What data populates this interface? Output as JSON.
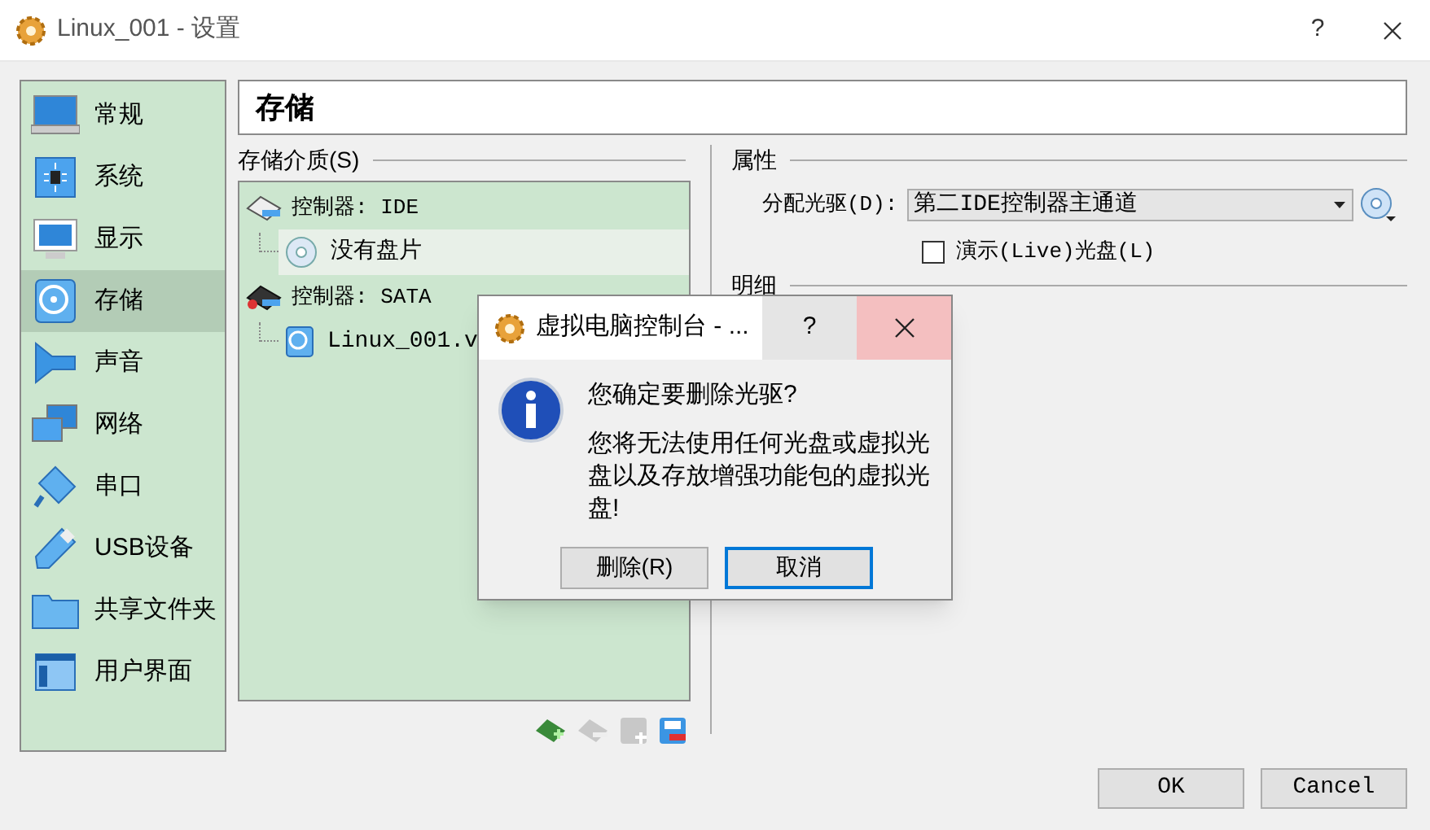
{
  "window": {
    "title": "Linux_001 - 设置",
    "help": "?"
  },
  "sidebar": {
    "items": [
      {
        "label": "常规",
        "kind": "general",
        "selected": false
      },
      {
        "label": "系统",
        "kind": "system",
        "selected": false
      },
      {
        "label": "显示",
        "kind": "display",
        "selected": false
      },
      {
        "label": "存储",
        "kind": "storage",
        "selected": true
      },
      {
        "label": "声音",
        "kind": "audio",
        "selected": false
      },
      {
        "label": "网络",
        "kind": "network",
        "selected": false
      },
      {
        "label": "串口",
        "kind": "serial",
        "selected": false
      },
      {
        "label": "USB设备",
        "kind": "usb",
        "selected": false
      },
      {
        "label": "共享文件夹",
        "kind": "folder",
        "selected": false
      },
      {
        "label": "用户界面",
        "kind": "ui",
        "selected": false
      }
    ]
  },
  "header": "存储",
  "storage": {
    "label": "存储介质(S)",
    "tree": [
      {
        "label": "控制器: IDE",
        "kind": "ide",
        "selected": false,
        "children": [
          {
            "label": "没有盘片",
            "kind": "optical",
            "selected": true
          }
        ]
      },
      {
        "label": "控制器: SATA",
        "kind": "sata",
        "selected": false,
        "children": [
          {
            "label": "Linux_001.v",
            "kind": "disk",
            "selected": false
          }
        ]
      }
    ],
    "toolbar": [
      {
        "kind": "add-controller",
        "disabled": false
      },
      {
        "kind": "remove-controller",
        "disabled": true
      },
      {
        "kind": "add-attachment",
        "disabled": true
      },
      {
        "kind": "remove-attachment",
        "disabled": false
      }
    ]
  },
  "attributes": {
    "title": "属性",
    "drive_label": "分配光驱(D):",
    "drive_value": "第二IDE控制器主通道",
    "live_cd": {
      "label": "演示(Live)光盘(L)",
      "checked": false
    },
    "details_title": "明细"
  },
  "buttons": [
    "OK",
    "Cancel"
  ],
  "dialog": {
    "title": "虚拟电脑控制台 - ...",
    "help": "?",
    "question": "您确定要删除光驱?",
    "message": "您将无法使用任何光盘或虚拟光盘以及存放增强功能包的虚拟光盘!",
    "buttons": [
      {
        "label": "删除(R)",
        "default": false
      },
      {
        "label": "取消",
        "default": true
      }
    ]
  }
}
